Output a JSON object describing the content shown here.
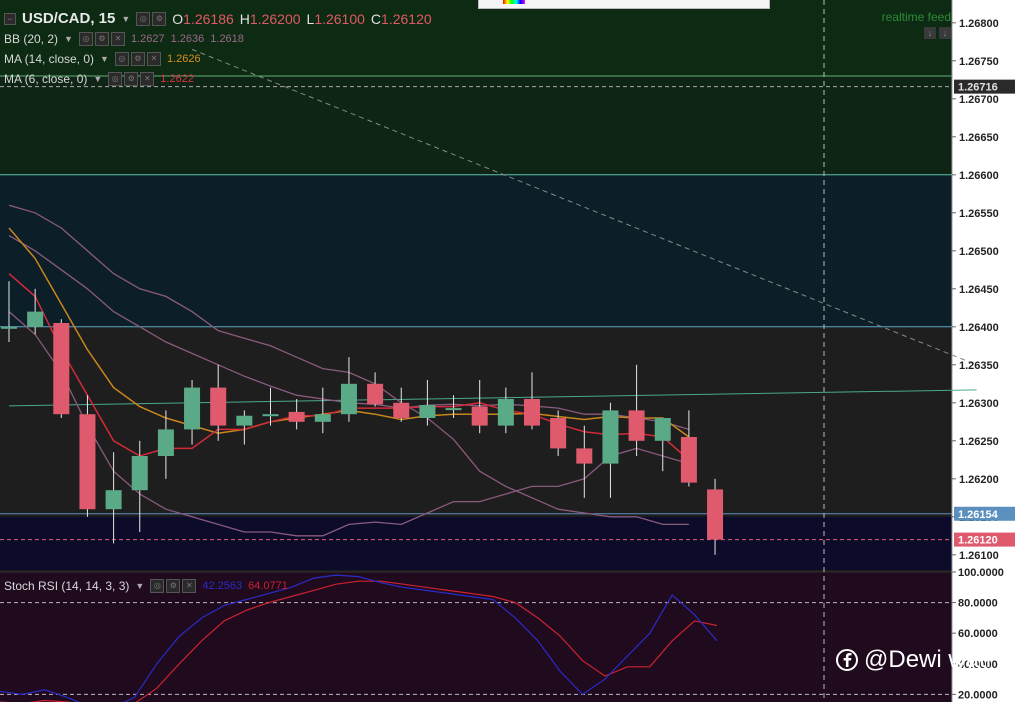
{
  "header": {
    "symbol": "USD/CAD, 15",
    "ohlc": [
      {
        "k": "O",
        "v": "1.26186"
      },
      {
        "k": "H",
        "v": "1.26200"
      },
      {
        "k": "L",
        "v": "1.26100"
      },
      {
        "k": "C",
        "v": "1.26120"
      }
    ]
  },
  "indicators": [
    {
      "name": "BB (20, 2)",
      "values": [
        "1.2627",
        "1.2636",
        "1.2618"
      ],
      "colors": [
        "#9a6a8c",
        "#9a6a8c",
        "#9a6a8c"
      ]
    },
    {
      "name": "MA (14, close, 0)",
      "values": [
        "1.2626"
      ],
      "colors": [
        "#d9901f"
      ]
    },
    {
      "name": "MA (6, close, 0)",
      "values": [
        "1.2622"
      ],
      "colors": [
        "#d8333f"
      ]
    }
  ],
  "realtime_label": "realtime feed",
  "stoch": {
    "name": "Stoch RSI (14, 14, 3, 3)",
    "k_value": "42.2563",
    "d_value": "64.0771",
    "k_color": "#2a2cc8",
    "d_color": "#cc2230"
  },
  "watermark": "@Dewi wati",
  "colors": {
    "up": "#5aaa88",
    "down": "#e05a6e",
    "bb": "#8a5a7e",
    "ma14": "#c8861c",
    "ma6": "#d22a38",
    "bg": "#1c1c1c"
  },
  "chart_data": {
    "type": "candlestick",
    "price_axis": {
      "ylim": [
        1.2608,
        1.2683
      ],
      "ticks": [
        "1.26800",
        "1.26750",
        "1.26700",
        "1.26650",
        "1.26600",
        "1.26550",
        "1.26500",
        "1.26450",
        "1.26400",
        "1.26350",
        "1.26300",
        "1.26250",
        "1.26200",
        "1.26150",
        "1.26100"
      ],
      "labels": [
        {
          "text": "1.26716",
          "value": 1.26716,
          "bg": "#2a2a2a",
          "fg": "#e0e0e0"
        },
        {
          "text": "1.26154",
          "value": 1.26154,
          "bg": "#5b8fbe",
          "fg": "#ffffff"
        },
        {
          "text": "1.26120",
          "value": 1.2612,
          "bg": "#e05a6e",
          "fg": "#ffffff"
        }
      ]
    },
    "zones": [
      {
        "from": 1.2673,
        "to": 1.2683,
        "color": "#0d2a12"
      },
      {
        "from": 1.266,
        "to": 1.2673,
        "color": "#0e2414"
      },
      {
        "from": 1.264,
        "to": 1.266,
        "color": "#0c1f28"
      },
      {
        "from": 1.2615,
        "to": 1.264,
        "color": "#1e1e1e"
      },
      {
        "from": 1.2608,
        "to": 1.2615,
        "color": "#0c0c2a"
      }
    ],
    "hlines": [
      {
        "value": 1.2673,
        "color": "#63b07a"
      },
      {
        "value": 1.266,
        "color": "#5fc2a8"
      },
      {
        "value": 1.264,
        "color": "#5aa8c8"
      },
      {
        "value": 1.26154,
        "color": "#5b8fbe"
      },
      {
        "value": 1.2612,
        "color": "#e05a6e",
        "dash": true
      },
      {
        "value": 1.26716,
        "color": "#aaaaaa",
        "dash": true
      }
    ],
    "trendlines": [
      {
        "p1": [
          0,
          1.26296
        ],
        "p2": [
          37,
          1.26317
        ],
        "color": "#4aa890",
        "dash": false
      },
      {
        "p1": [
          7,
          1.26765
        ],
        "p2": [
          37,
          1.2635
        ],
        "color": "#888888",
        "dash": true
      }
    ],
    "candles": [
      {
        "o": 1.264,
        "h": 1.2646,
        "l": 1.2638,
        "c": 1.264
      },
      {
        "o": 1.264,
        "h": 1.2645,
        "l": 1.2639,
        "c": 1.2642
      },
      {
        "o": 1.26405,
        "h": 1.2641,
        "l": 1.2628,
        "c": 1.26285
      },
      {
        "o": 1.26285,
        "h": 1.2631,
        "l": 1.2615,
        "c": 1.2616
      },
      {
        "o": 1.2616,
        "h": 1.26235,
        "l": 1.26115,
        "c": 1.26185
      },
      {
        "o": 1.26185,
        "h": 1.2625,
        "l": 1.2613,
        "c": 1.2623
      },
      {
        "o": 1.2623,
        "h": 1.2629,
        "l": 1.262,
        "c": 1.26265
      },
      {
        "o": 1.26265,
        "h": 1.2633,
        "l": 1.26245,
        "c": 1.2632
      },
      {
        "o": 1.2632,
        "h": 1.2635,
        "l": 1.2625,
        "c": 1.2627
      },
      {
        "o": 1.2627,
        "h": 1.2629,
        "l": 1.26245,
        "c": 1.26283
      },
      {
        "o": 1.26283,
        "h": 1.2632,
        "l": 1.2627,
        "c": 1.26285
      },
      {
        "o": 1.26288,
        "h": 1.26305,
        "l": 1.26265,
        "c": 1.26275
      },
      {
        "o": 1.26275,
        "h": 1.2632,
        "l": 1.2626,
        "c": 1.26285
      },
      {
        "o": 1.26285,
        "h": 1.2636,
        "l": 1.26275,
        "c": 1.26325
      },
      {
        "o": 1.26325,
        "h": 1.2634,
        "l": 1.26295,
        "c": 1.26298
      },
      {
        "o": 1.263,
        "h": 1.2632,
        "l": 1.26275,
        "c": 1.2628
      },
      {
        "o": 1.2628,
        "h": 1.2633,
        "l": 1.2627,
        "c": 1.26297
      },
      {
        "o": 1.26293,
        "h": 1.2631,
        "l": 1.2628,
        "c": 1.26293
      },
      {
        "o": 1.26295,
        "h": 1.2633,
        "l": 1.2626,
        "c": 1.2627
      },
      {
        "o": 1.2627,
        "h": 1.2632,
        "l": 1.2626,
        "c": 1.26305
      },
      {
        "o": 1.26305,
        "h": 1.2634,
        "l": 1.26265,
        "c": 1.2627
      },
      {
        "o": 1.2628,
        "h": 1.2629,
        "l": 1.2623,
        "c": 1.2624
      },
      {
        "o": 1.2624,
        "h": 1.2627,
        "l": 1.26175,
        "c": 1.2622
      },
      {
        "o": 1.2622,
        "h": 1.263,
        "l": 1.26175,
        "c": 1.2629
      },
      {
        "o": 1.2629,
        "h": 1.2635,
        "l": 1.2623,
        "c": 1.2625
      },
      {
        "o": 1.2625,
        "h": 1.2628,
        "l": 1.2621,
        "c": 1.2628
      },
      {
        "o": 1.26255,
        "h": 1.2629,
        "l": 1.2619,
        "c": 1.26195
      },
      {
        "o": 1.26186,
        "h": 1.262,
        "l": 1.261,
        "c": 1.2612
      }
    ],
    "bb_upper": [
      1.2656,
      1.2655,
      1.2653,
      1.265,
      1.2647,
      1.2645,
      1.2644,
      1.2642,
      1.26395,
      1.26385,
      1.26375,
      1.2636,
      1.26345,
      1.2634,
      1.26325,
      1.263,
      1.2628,
      1.26252,
      1.2621,
      1.2619,
      1.26175,
      1.2616,
      1.26155,
      1.2615,
      1.2615,
      1.2614,
      1.2614,
      null
    ],
    "bb_middle": [
      1.2652,
      1.265,
      1.26475,
      1.2645,
      1.2642,
      1.264,
      1.2638,
      1.26365,
      1.2635,
      1.26335,
      1.26322,
      1.2631,
      1.26305,
      1.263,
      1.26298,
      1.26293,
      1.26297,
      1.26298,
      1.26296,
      1.26298,
      1.26296,
      1.26293,
      1.26285,
      1.26285,
      1.2628,
      1.26275,
      1.26265,
      null
    ],
    "bb_lower": [
      1.2642,
      1.2639,
      1.2634,
      1.2627,
      1.2621,
      1.2618,
      1.2616,
      1.2615,
      1.2614,
      1.2613,
      1.2613,
      1.26125,
      1.26125,
      1.2614,
      1.26143,
      1.2614,
      1.26155,
      1.2617,
      1.2617,
      1.2618,
      1.2619,
      1.2619,
      1.262,
      1.2623,
      1.2624,
      1.2623,
      1.2622,
      null
    ],
    "ma14": [
      1.2653,
      1.2649,
      1.2643,
      1.2637,
      1.2632,
      1.26295,
      1.2628,
      1.2627,
      1.2626,
      1.26265,
      1.26275,
      1.2628,
      1.26285,
      1.2629,
      1.26285,
      1.26278,
      1.26283,
      1.26285,
      1.26285,
      1.26285,
      1.26286,
      1.26282,
      1.26278,
      1.26282,
      1.2628,
      1.2628,
      1.26255,
      null
    ],
    "ma6": [
      1.2647,
      1.2644,
      1.2637,
      1.2631,
      1.2625,
      1.2623,
      1.2624,
      1.2624,
      1.26265,
      1.26265,
      1.26275,
      1.26283,
      1.26283,
      1.26293,
      1.26293,
      1.26293,
      1.26295,
      1.26295,
      1.263,
      1.2629,
      1.26285,
      1.26272,
      1.26262,
      1.26258,
      1.2626,
      1.26255,
      1.26225,
      null
    ],
    "stoch_rsi": {
      "ylim": [
        15,
        100
      ],
      "ticks": [
        "100.0000",
        "80.0000",
        "60.0000",
        "40.0000",
        "20.0000"
      ],
      "k": [
        22,
        20,
        23,
        18,
        12,
        11,
        18,
        40,
        58,
        70,
        78,
        82,
        86,
        90,
        96,
        98,
        97,
        93,
        90,
        88,
        86,
        84,
        82,
        70,
        55,
        35,
        20,
        30,
        45,
        60,
        85,
        72,
        55
      ],
      "d": [
        15,
        14,
        16,
        15,
        13,
        11,
        14,
        24,
        40,
        55,
        68,
        75,
        80,
        84,
        88,
        92,
        94,
        94,
        92,
        90,
        88,
        86,
        84,
        80,
        70,
        58,
        42,
        32,
        38,
        38,
        55,
        68,
        65
      ]
    }
  }
}
